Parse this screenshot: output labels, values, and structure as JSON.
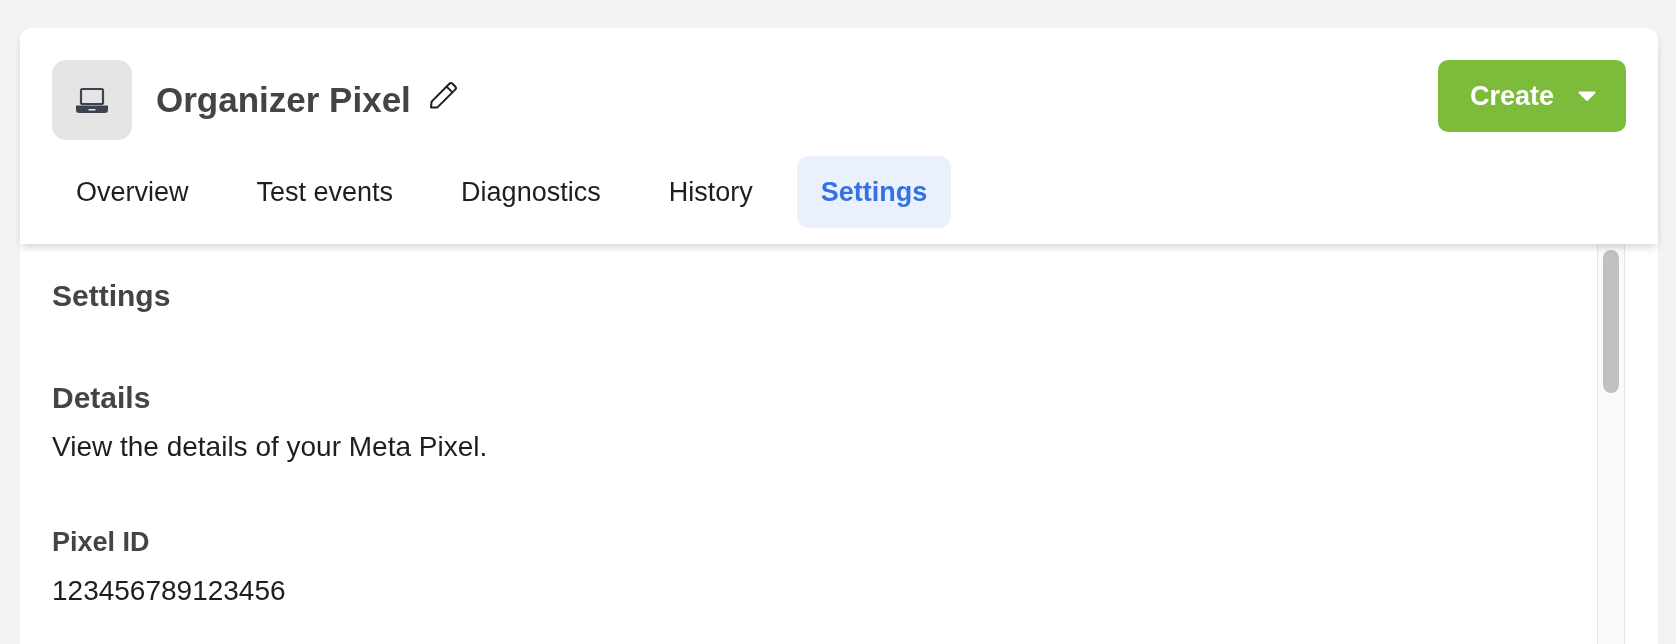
{
  "header": {
    "title": "Organizer Pixel",
    "create_button": {
      "label": "Create"
    }
  },
  "tabs": [
    {
      "label": "Overview",
      "selected": false
    },
    {
      "label": "Test events",
      "selected": false
    },
    {
      "label": "Diagnostics",
      "selected": false
    },
    {
      "label": "History",
      "selected": false
    },
    {
      "label": "Settings",
      "selected": true
    }
  ],
  "content": {
    "title": "Settings",
    "sections": [
      {
        "heading": "Details",
        "description": "View the details of your Meta Pixel.",
        "fields": [
          {
            "label": "Pixel ID",
            "value": "123456789123456"
          }
        ]
      }
    ]
  }
}
